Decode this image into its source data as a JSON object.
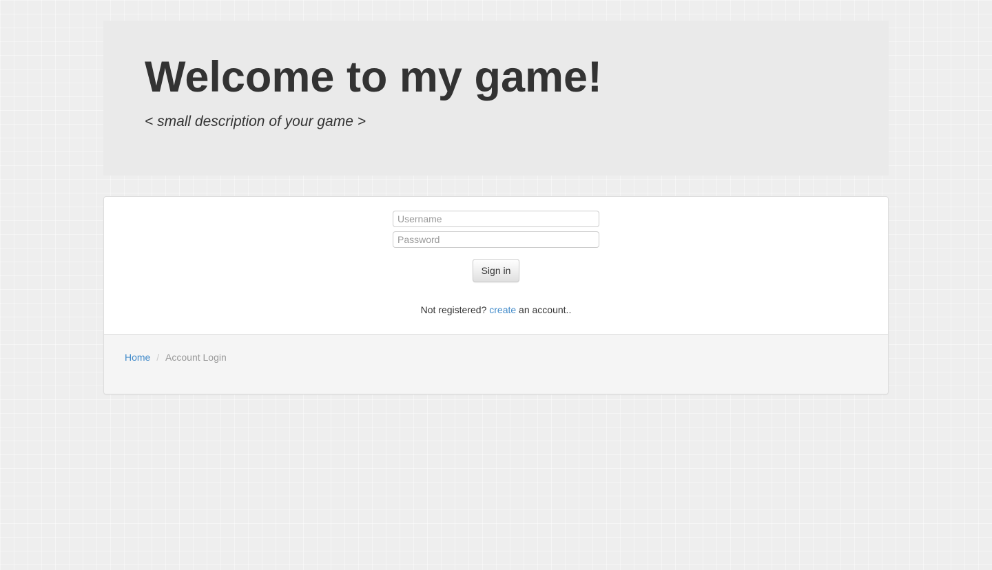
{
  "jumbotron": {
    "title": "Welcome to my game!",
    "subtitle": "< small description of your game >"
  },
  "form": {
    "username_placeholder": "Username",
    "password_placeholder": "Password",
    "signin_label": "Sign in"
  },
  "register": {
    "prefix": "Not registered? ",
    "link_text": "create",
    "suffix": " an account.."
  },
  "breadcrumb": {
    "home": "Home",
    "current": "Account Login"
  }
}
